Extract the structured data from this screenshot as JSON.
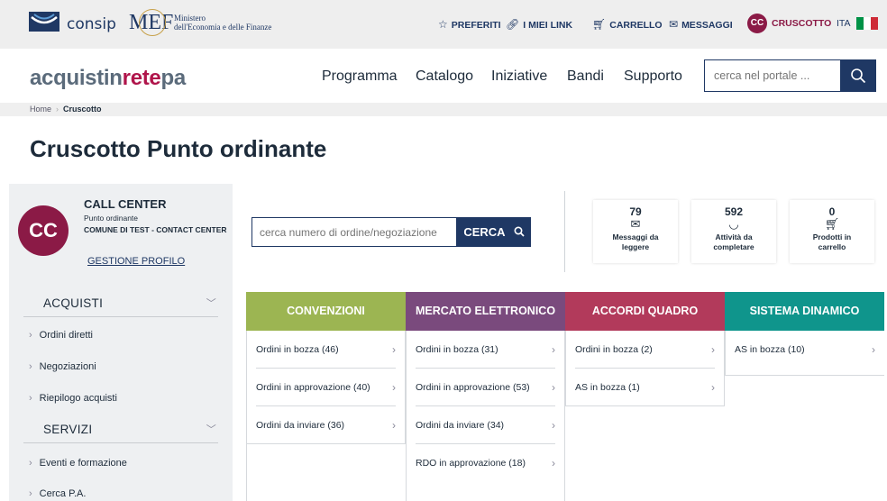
{
  "topbar": {
    "consip": "consip",
    "mef_mark": "MEF",
    "mef_line1": "Ministero",
    "mef_line2": "dell'Economia e delle Finanze",
    "preferiti": "PREFERITI",
    "miei_link": "I MIEI LINK",
    "carrello": "CARRELLO",
    "messaggi": "MESSAGGI",
    "user_initials": "CC",
    "cruscotto": "CRUSCOTTO",
    "lang": "ITA",
    "flag_colors": [
      "#009246",
      "#ffffff",
      "#ce2b37"
    ]
  },
  "nav": {
    "brand_a": "acquistin",
    "brand_b": "rete",
    "brand_c": "pa",
    "items": [
      "Programma",
      "Catalogo",
      "Iniziative",
      "Bandi",
      "Supporto"
    ],
    "search_placeholder": "cerca nel portale ..."
  },
  "breadcrumb": {
    "home": "Home",
    "current": "Cruscotto"
  },
  "page_title": "Cruscotto Punto ordinante",
  "profile": {
    "initials": "CC",
    "name": "CALL CENTER",
    "role": "Punto ordinante",
    "org": "COMUNE DI TEST - CONTACT CENTER",
    "manage_link": "GESTIONE PROFILO"
  },
  "sidebar": {
    "acquisti": "ACQUISTI",
    "acquisti_items": [
      "Ordini diretti",
      "Negoziazioni",
      "Riepilogo acquisti"
    ],
    "servizi": "SERVIZI",
    "servizi_items": [
      "Eventi e formazione",
      "Cerca P.A."
    ]
  },
  "order_search": {
    "placeholder": "cerca numero di ordine/negoziazione",
    "button": "CERCA"
  },
  "counters": [
    {
      "value": "79",
      "label1": "Messaggi da",
      "label2": "leggere"
    },
    {
      "value": "592",
      "label1": "Attività da",
      "label2": "completare"
    },
    {
      "value": "0",
      "label1": "Prodotti in",
      "label2": "carrello"
    }
  ],
  "columns": [
    {
      "title": "CONVENZIONI",
      "color": "#9cb552",
      "rows": [
        "Ordini in bozza (46)",
        "Ordini in approvazione (40)",
        "Ordini da inviare (36)"
      ]
    },
    {
      "title": "MERCATO ELETTRONICO",
      "color": "#7a4a7d",
      "rows": [
        "Ordini in bozza (31)",
        "Ordini in approvazione (53)",
        "Ordini da inviare (34)",
        "RDO in approvazione (18)"
      ]
    },
    {
      "title": "ACCORDI QUADRO",
      "color": "#b23a5b",
      "rows": [
        "Ordini in bozza (2)",
        "AS in bozza (1)"
      ]
    },
    {
      "title": "SISTEMA DINAMICO",
      "color": "#0f958c",
      "rows": [
        "AS in bozza (10)"
      ]
    }
  ]
}
